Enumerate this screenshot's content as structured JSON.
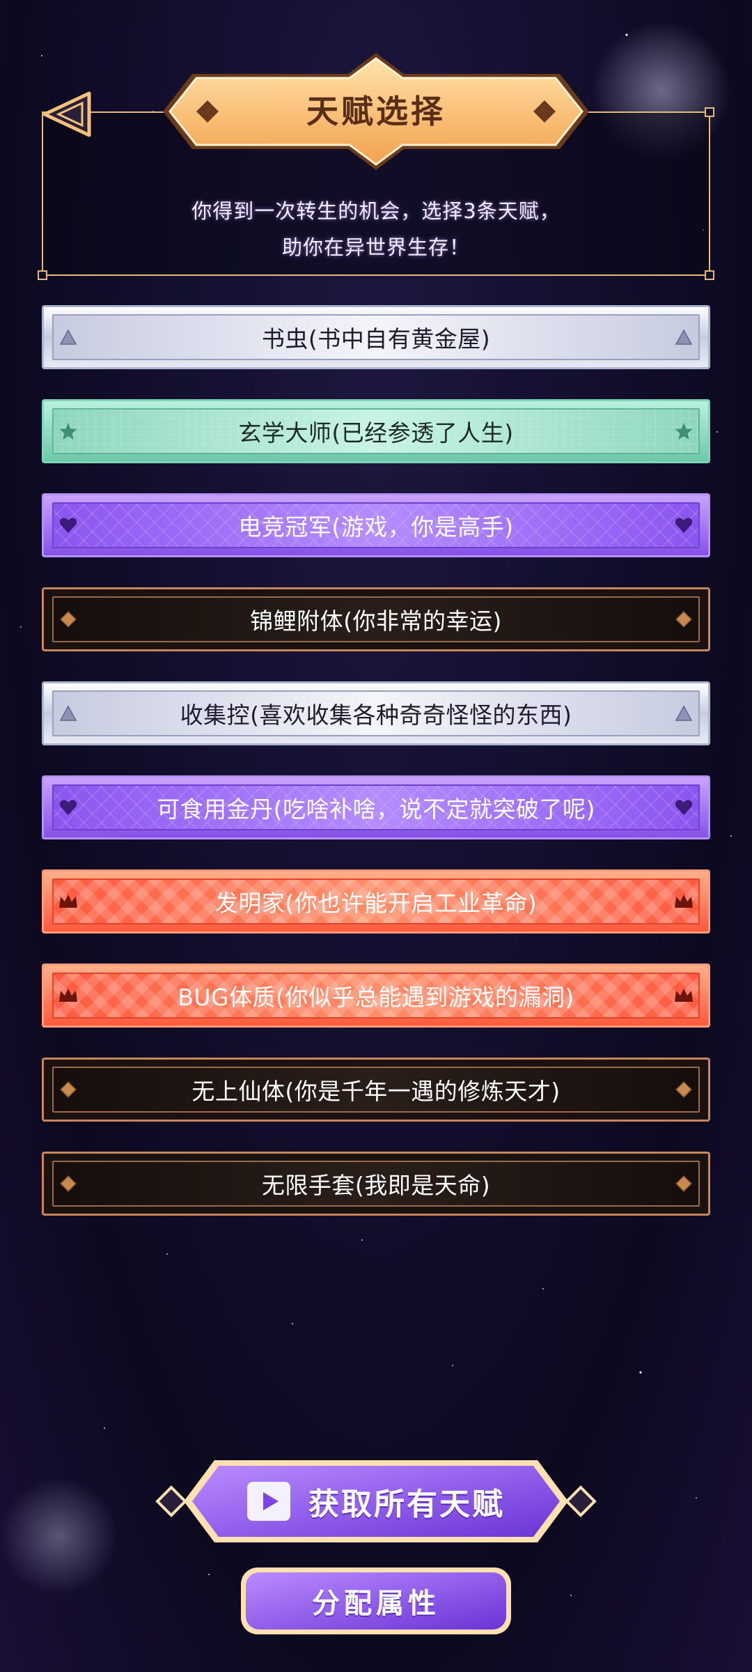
{
  "header": {
    "title": "天赋选择",
    "intro_line1": "你得到一次转生的机会，选择3条天赋，",
    "intro_line2": "助你在异世界生存！"
  },
  "talents": [
    {
      "label": "书虫(书中自有黄金屋)",
      "style": "silver",
      "icon": "triangle-gem-icon"
    },
    {
      "label": "玄学大师(已经参透了人生)",
      "style": "jade",
      "icon": "star-gem-icon"
    },
    {
      "label": "电竞冠军(游戏，你是高手)",
      "style": "purple",
      "icon": "heart-gem-icon"
    },
    {
      "label": "锦鲤附体(你非常的幸运)",
      "style": "dark",
      "icon": "diamond-gem-icon"
    },
    {
      "label": "收集控(喜欢收集各种奇奇怪怪的东西)",
      "style": "silver",
      "icon": "triangle-gem-icon"
    },
    {
      "label": "可食用金丹(吃啥补啥，说不定就突破了呢)",
      "style": "purple",
      "icon": "heart-gem-icon"
    },
    {
      "label": "发明家(你也许能开启工业革命)",
      "style": "red",
      "icon": "crown-icon"
    },
    {
      "label": "BUG体质(你似乎总能遇到游戏的漏洞)",
      "style": "red",
      "icon": "crown-icon"
    },
    {
      "label": "无上仙体(你是千年一遇的修炼天才)",
      "style": "dark",
      "icon": "diamond-gem-icon"
    },
    {
      "label": "无限手套(我即是天命)",
      "style": "dark",
      "icon": "diamond-gem-icon"
    }
  ],
  "buttons": {
    "get_all": "获取所有天赋",
    "allocate": "分配属性"
  },
  "colors": {
    "gold_border": "#e8b97a",
    "title_banner": "#f7b567",
    "button_purple": "#8a55ef"
  }
}
